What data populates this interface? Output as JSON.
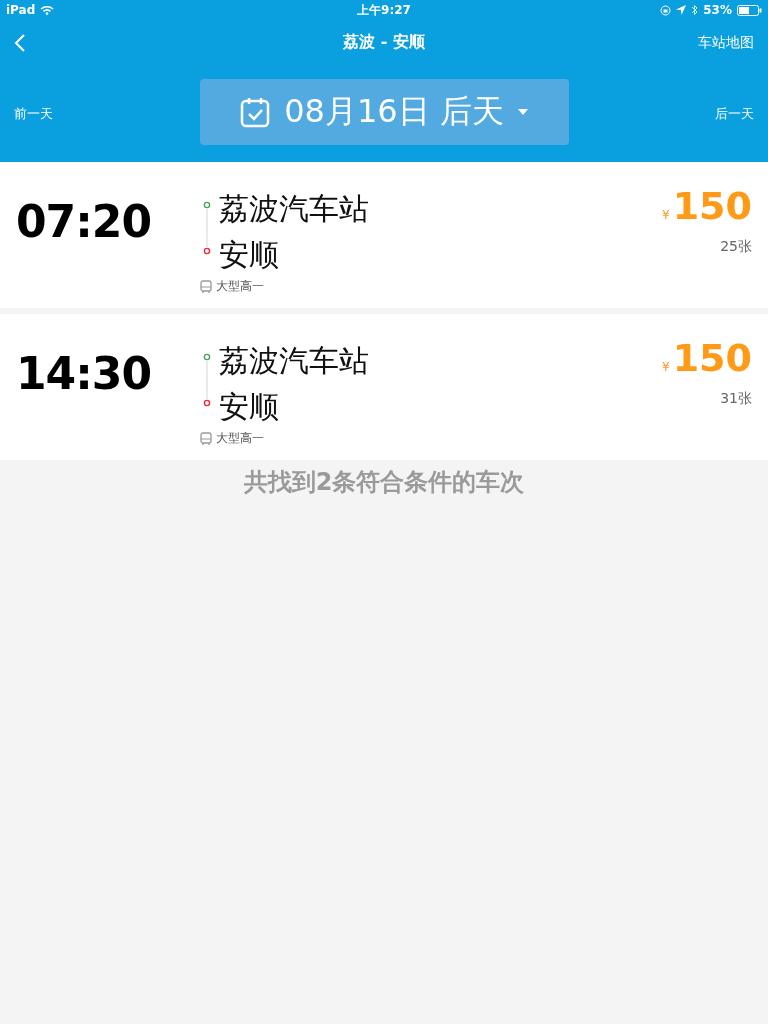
{
  "status_bar": {
    "device": "iPad",
    "time": "上午9:27",
    "battery": "53%"
  },
  "nav": {
    "title": "荔波 - 安顺",
    "action": "车站地图"
  },
  "date_bar": {
    "prev": "前一天",
    "date": "08月16日 后天",
    "next": "后一天"
  },
  "trips": [
    {
      "time": "07:20",
      "from": "荔波汽车站",
      "to": "安顺",
      "bus_type": "大型高一",
      "currency": "¥",
      "price": "150",
      "tickets": "25张"
    },
    {
      "time": "14:30",
      "from": "荔波汽车站",
      "to": "安顺",
      "bus_type": "大型高一",
      "currency": "¥",
      "price": "150",
      "tickets": "31张"
    }
  ],
  "summary": "共找到2条符合条件的车次"
}
